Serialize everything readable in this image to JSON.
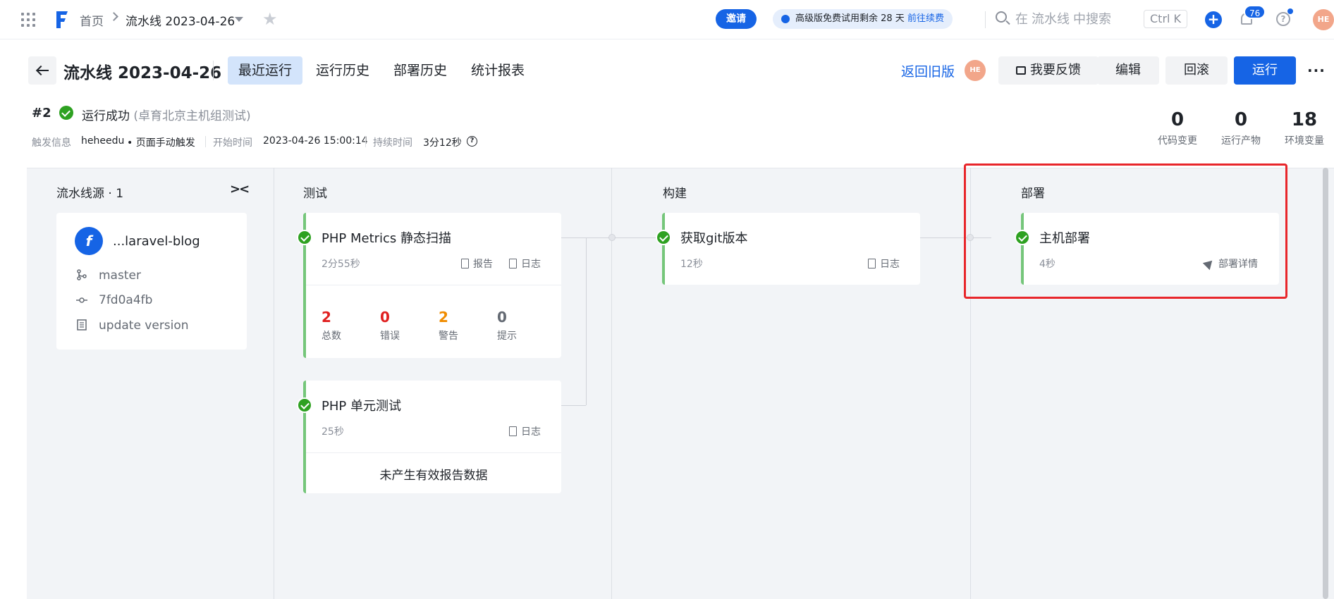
{
  "topbar": {
    "breadcrumb_home": "首页",
    "breadcrumb_current": "流水线 2023-04-26",
    "invite_label": "邀请",
    "trial_text": "高级版免费试用剩余 28 天",
    "trial_link": "前往续费",
    "search_placeholder": "在 流水线 中搜索",
    "shortcut": "Ctrl K",
    "notification_count": "76",
    "avatar": "HE"
  },
  "header": {
    "title": "流水线 2023-04-26",
    "tabs": [
      "最近运行",
      "运行历史",
      "部署历史",
      "统计报表"
    ],
    "active_tab": 0,
    "old_version_link": "返回旧版",
    "avatar": "HE",
    "feedback_label": "我要反馈",
    "edit_label": "编辑",
    "rollback_label": "回滚",
    "run_label": "运行",
    "more_label": "···"
  },
  "run": {
    "number": "#2",
    "status": "运行成功",
    "detail": "(卓育北京主机组测试)",
    "trigger_label": "触发信息",
    "trigger_user": "heheedu",
    "trigger_type": "• 页面手动触发",
    "start_label": "开始时间",
    "start_time": "2023-04-26 15:00:14",
    "duration_label": "持续时间",
    "duration": "3分12秒"
  },
  "stats": [
    {
      "value": "0",
      "label": "代码变更"
    },
    {
      "value": "0",
      "label": "运行产物"
    },
    {
      "value": "18",
      "label": "环境变量"
    }
  ],
  "pipeline": {
    "source": {
      "title": "流水线源 · 1",
      "repo": "...laravel-blog",
      "branch": "master",
      "commit": "7fd0a4fb",
      "message": "update version"
    },
    "stages": [
      {
        "title": "测试",
        "jobs": [
          {
            "name": "PHP Metrics 静态扫描",
            "duration": "2分55秒",
            "actions": [
              "报告",
              "日志"
            ],
            "metrics": [
              {
                "value": "2",
                "label": "总数",
                "color": "#e02020"
              },
              {
                "value": "0",
                "label": "错误",
                "color": "#e02020"
              },
              {
                "value": "2",
                "label": "警告",
                "color": "#f08c00"
              },
              {
                "value": "0",
                "label": "提示",
                "color": "#646a73"
              }
            ]
          },
          {
            "name": "PHP 单元测试",
            "duration": "25秒",
            "actions": [
              "日志"
            ],
            "note": "未产生有效报告数据"
          }
        ]
      },
      {
        "title": "构建",
        "jobs": [
          {
            "name": "获取git版本",
            "duration": "12秒",
            "actions": [
              "日志"
            ]
          }
        ]
      },
      {
        "title": "部署",
        "jobs": [
          {
            "name": "主机部署",
            "duration": "4秒",
            "actions": [
              "部署详情"
            ]
          }
        ]
      }
    ]
  },
  "colors": {
    "primary": "#1664e5",
    "success": "#2ea121",
    "highlight": "#e8262b",
    "job_accent": "#75c67a"
  }
}
